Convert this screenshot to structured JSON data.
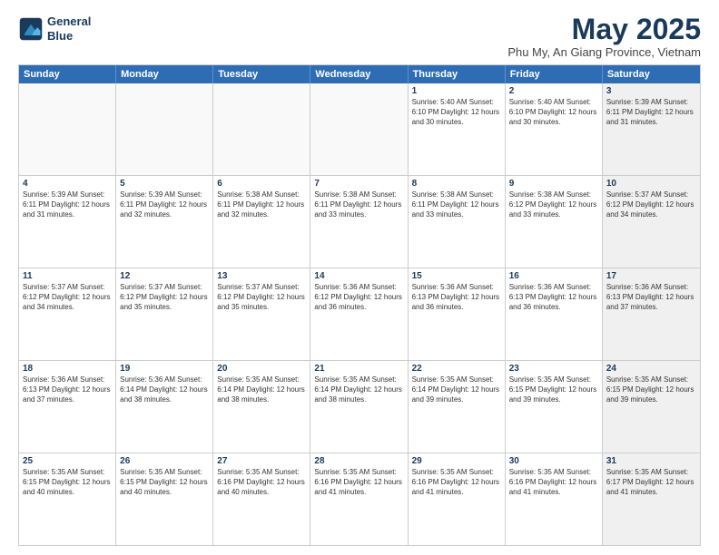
{
  "logo": {
    "line1": "General",
    "line2": "Blue"
  },
  "title": "May 2025",
  "subtitle": "Phu My, An Giang Province, Vietnam",
  "dayHeaders": [
    "Sunday",
    "Monday",
    "Tuesday",
    "Wednesday",
    "Thursday",
    "Friday",
    "Saturday"
  ],
  "weeks": [
    [
      {
        "num": "",
        "info": "",
        "empty": true
      },
      {
        "num": "",
        "info": "",
        "empty": true
      },
      {
        "num": "",
        "info": "",
        "empty": true
      },
      {
        "num": "",
        "info": "",
        "empty": true
      },
      {
        "num": "1",
        "info": "Sunrise: 5:40 AM\nSunset: 6:10 PM\nDaylight: 12 hours\nand 30 minutes."
      },
      {
        "num": "2",
        "info": "Sunrise: 5:40 AM\nSunset: 6:10 PM\nDaylight: 12 hours\nand 30 minutes."
      },
      {
        "num": "3",
        "info": "Sunrise: 5:39 AM\nSunset: 6:11 PM\nDaylight: 12 hours\nand 31 minutes.",
        "shaded": true
      }
    ],
    [
      {
        "num": "4",
        "info": "Sunrise: 5:39 AM\nSunset: 6:11 PM\nDaylight: 12 hours\nand 31 minutes."
      },
      {
        "num": "5",
        "info": "Sunrise: 5:39 AM\nSunset: 6:11 PM\nDaylight: 12 hours\nand 32 minutes."
      },
      {
        "num": "6",
        "info": "Sunrise: 5:38 AM\nSunset: 6:11 PM\nDaylight: 12 hours\nand 32 minutes."
      },
      {
        "num": "7",
        "info": "Sunrise: 5:38 AM\nSunset: 6:11 PM\nDaylight: 12 hours\nand 33 minutes."
      },
      {
        "num": "8",
        "info": "Sunrise: 5:38 AM\nSunset: 6:11 PM\nDaylight: 12 hours\nand 33 minutes."
      },
      {
        "num": "9",
        "info": "Sunrise: 5:38 AM\nSunset: 6:12 PM\nDaylight: 12 hours\nand 33 minutes."
      },
      {
        "num": "10",
        "info": "Sunrise: 5:37 AM\nSunset: 6:12 PM\nDaylight: 12 hours\nand 34 minutes.",
        "shaded": true
      }
    ],
    [
      {
        "num": "11",
        "info": "Sunrise: 5:37 AM\nSunset: 6:12 PM\nDaylight: 12 hours\nand 34 minutes."
      },
      {
        "num": "12",
        "info": "Sunrise: 5:37 AM\nSunset: 6:12 PM\nDaylight: 12 hours\nand 35 minutes."
      },
      {
        "num": "13",
        "info": "Sunrise: 5:37 AM\nSunset: 6:12 PM\nDaylight: 12 hours\nand 35 minutes."
      },
      {
        "num": "14",
        "info": "Sunrise: 5:36 AM\nSunset: 6:12 PM\nDaylight: 12 hours\nand 36 minutes."
      },
      {
        "num": "15",
        "info": "Sunrise: 5:36 AM\nSunset: 6:13 PM\nDaylight: 12 hours\nand 36 minutes."
      },
      {
        "num": "16",
        "info": "Sunrise: 5:36 AM\nSunset: 6:13 PM\nDaylight: 12 hours\nand 36 minutes."
      },
      {
        "num": "17",
        "info": "Sunrise: 5:36 AM\nSunset: 6:13 PM\nDaylight: 12 hours\nand 37 minutes.",
        "shaded": true
      }
    ],
    [
      {
        "num": "18",
        "info": "Sunrise: 5:36 AM\nSunset: 6:13 PM\nDaylight: 12 hours\nand 37 minutes."
      },
      {
        "num": "19",
        "info": "Sunrise: 5:36 AM\nSunset: 6:14 PM\nDaylight: 12 hours\nand 38 minutes."
      },
      {
        "num": "20",
        "info": "Sunrise: 5:35 AM\nSunset: 6:14 PM\nDaylight: 12 hours\nand 38 minutes."
      },
      {
        "num": "21",
        "info": "Sunrise: 5:35 AM\nSunset: 6:14 PM\nDaylight: 12 hours\nand 38 minutes."
      },
      {
        "num": "22",
        "info": "Sunrise: 5:35 AM\nSunset: 6:14 PM\nDaylight: 12 hours\nand 39 minutes."
      },
      {
        "num": "23",
        "info": "Sunrise: 5:35 AM\nSunset: 6:15 PM\nDaylight: 12 hours\nand 39 minutes."
      },
      {
        "num": "24",
        "info": "Sunrise: 5:35 AM\nSunset: 6:15 PM\nDaylight: 12 hours\nand 39 minutes.",
        "shaded": true
      }
    ],
    [
      {
        "num": "25",
        "info": "Sunrise: 5:35 AM\nSunset: 6:15 PM\nDaylight: 12 hours\nand 40 minutes."
      },
      {
        "num": "26",
        "info": "Sunrise: 5:35 AM\nSunset: 6:15 PM\nDaylight: 12 hours\nand 40 minutes."
      },
      {
        "num": "27",
        "info": "Sunrise: 5:35 AM\nSunset: 6:16 PM\nDaylight: 12 hours\nand 40 minutes."
      },
      {
        "num": "28",
        "info": "Sunrise: 5:35 AM\nSunset: 6:16 PM\nDaylight: 12 hours\nand 41 minutes."
      },
      {
        "num": "29",
        "info": "Sunrise: 5:35 AM\nSunset: 6:16 PM\nDaylight: 12 hours\nand 41 minutes."
      },
      {
        "num": "30",
        "info": "Sunrise: 5:35 AM\nSunset: 6:16 PM\nDaylight: 12 hours\nand 41 minutes."
      },
      {
        "num": "31",
        "info": "Sunrise: 5:35 AM\nSunset: 6:17 PM\nDaylight: 12 hours\nand 41 minutes.",
        "shaded": true
      }
    ]
  ]
}
